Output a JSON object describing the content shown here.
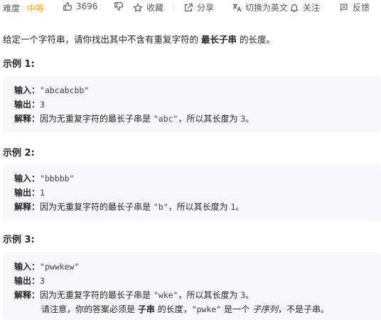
{
  "toolbar": {
    "difficulty_label": "难度",
    "difficulty_value": "中等",
    "difficulty_color": "#ffa116",
    "like_count": "3696",
    "favorite_label": "收藏",
    "share_label": "分享",
    "translate_label": "切换为英文",
    "follow_label": "关注",
    "feedback_label": "反馈",
    "icons": [
      "thumbs-up-icon",
      "thumbs-down-icon",
      "star-icon",
      "share-icon",
      "translate-icon",
      "bell-icon",
      "flag-icon"
    ]
  },
  "description": {
    "prefix": "给定一个字符串，请你找出其中不含有重复字符的",
    "bold": "最长子串",
    "suffix": "的长度。"
  },
  "examples": [
    {
      "title": "示例 1:",
      "input_key": "输入：",
      "input_value": "\"abcabcbb\"",
      "output_key": "输出：",
      "output_value": "3",
      "explain_key": "解释：",
      "explain_prefix": "因为无重复字符的最长子串是",
      "explain_code": "\"abc\"",
      "explain_suffix": "，所以其长度为",
      "explain_num": "3。"
    },
    {
      "title": "示例 2:",
      "input_key": "输入：",
      "input_value": "\"bbbbb\"",
      "output_key": "输出：",
      "output_value": "1",
      "explain_key": "解释：",
      "explain_prefix": "因为无重复字符的最长子串是",
      "explain_code": "\"b\"",
      "explain_suffix": "，所以其长度为",
      "explain_num": "1。"
    },
    {
      "title": "示例 3:",
      "input_key": "输入：",
      "input_value": "\"pwwkew\"",
      "output_key": "输出：",
      "output_value": "3",
      "explain_key": "解释：",
      "explain_prefix": "因为无重复字符的最长子串是",
      "explain_code": "\"wke\"",
      "explain_suffix": "，所以其长度为",
      "explain_num": "3。",
      "note_prefix": "请注意，你的答案必须是",
      "note_bold": "子串",
      "note_middle": "的长度，",
      "note_code": "\"pwke\"",
      "note_mid2": "是一个",
      "note_italic": "子序列",
      "note_suffix": "，不是子串。"
    }
  ]
}
